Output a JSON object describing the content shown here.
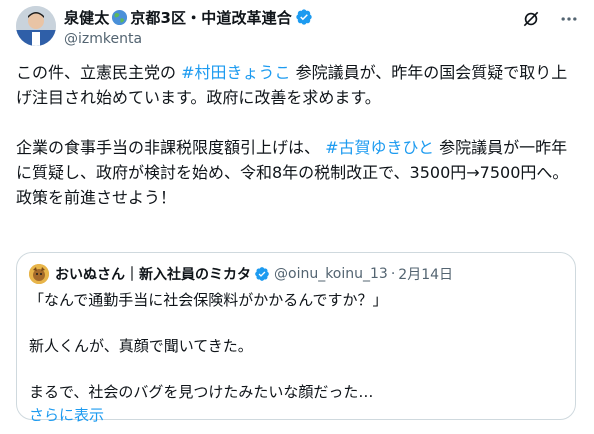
{
  "author": {
    "display_name_part1": "泉健太",
    "display_name_part2": "京都3区・中道改革連合",
    "handle": "@izmkenta",
    "avatar_icon": "profile-photo",
    "globe_icon": "globe-emoji-icon",
    "verified_icon": "verified-badge-icon"
  },
  "top_actions": [
    {
      "icon": "grok-explain-icon"
    },
    {
      "icon": "more-icon"
    }
  ],
  "post": {
    "p1_a": "この件、立憲民主党の ",
    "p1_tag": "#村田きょうこ",
    "p1_b": " 参院議員が、昨年の国会質疑で取り上げ注目され始めています。政府に改善を求めます。",
    "p2_a": "企業の食事手当の非課税限度額引上げは、 ",
    "p2_tag": "#古賀ゆきひと",
    "p2_b": " 参院議員が一昨年に質疑し、政府が検討を始め、令和8年の税制改正で、3500円→7500円へ。",
    "p3": "政策を前進させよう！"
  },
  "quote": {
    "display_name": "おいぬさん｜新入社員のミカタ",
    "handle": "@oinu_koinu_13",
    "separator": "·",
    "date": "2月14日",
    "line1": "「なんで通勤手当に社会保険料がかかるんですか？」",
    "line2": "新人くんが、真顔で聞いてきた。",
    "line3": "まるで、社会のバグを見つけたみたいな顔だった…",
    "show_more": "さらに表示"
  },
  "colors": {
    "link": "#1d9bf0",
    "secondary_text": "#536471",
    "border": "#cfd9de",
    "verified": "#1d9bf0"
  }
}
